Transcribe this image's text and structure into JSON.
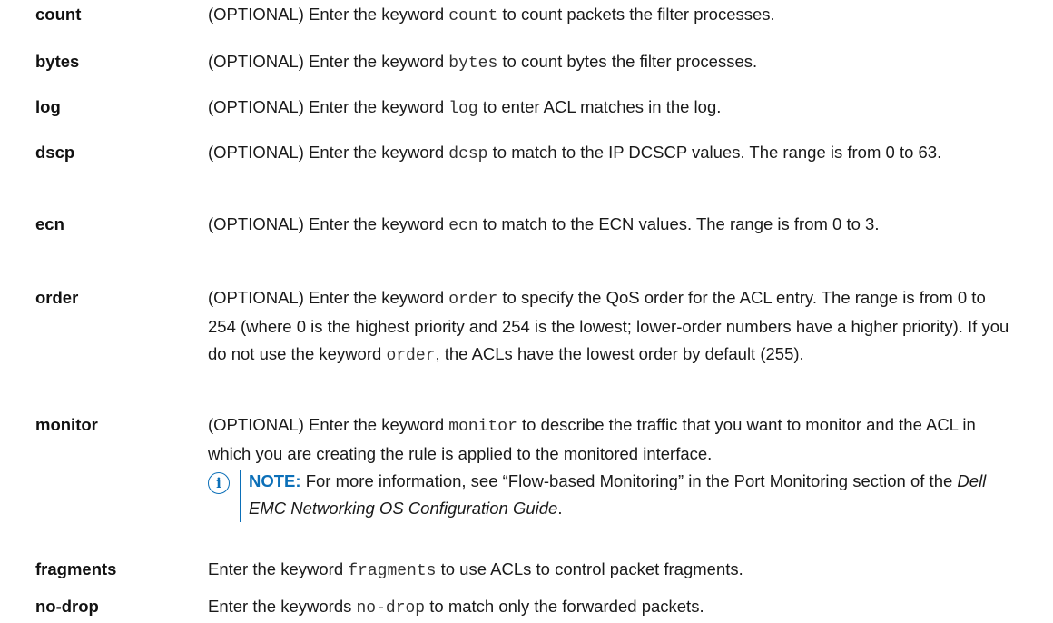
{
  "rows": [
    {
      "term": "count",
      "parts": [
        "(OPTIONAL) Enter the keyword ",
        "count",
        " to count packets the filter processes."
      ]
    },
    {
      "term": "bytes",
      "parts": [
        "(OPTIONAL) Enter the keyword ",
        "bytes",
        " to count bytes the filter processes."
      ]
    },
    {
      "term": "log",
      "parts": [
        "(OPTIONAL) Enter the keyword ",
        "log",
        " to enter ACL matches in the log."
      ]
    },
    {
      "term": "dscp",
      "parts": [
        "(OPTIONAL) Enter the keyword ",
        "dcsp",
        " to match to the IP DCSCP values. The range is from 0 to 63."
      ]
    },
    {
      "term": "ecn",
      "parts": [
        "(OPTIONAL) Enter the keyword ",
        "ecn",
        " to match to the ECN values. The range is from 0 to 3."
      ]
    },
    {
      "term": "order",
      "parts": [
        "(OPTIONAL) Enter the keyword ",
        "order",
        " to specify the QoS order for the ACL entry. The range is from 0 to 254 (where 0 is the highest priority and 254 is the lowest; lower-order numbers have a higher priority). If you do not use the keyword ",
        "order",
        ", the ACLs have the lowest order by default (255)."
      ]
    },
    {
      "term": "monitor",
      "parts": [
        "(OPTIONAL) Enter the keyword ",
        "monitor",
        " to describe the traffic that you want to monitor and the ACL in which you are creating the rule is applied to the monitored interface."
      ]
    },
    {
      "term": "fragments",
      "parts": [
        "Enter the keyword ",
        "fragments",
        " to use ACLs to control packet fragments."
      ]
    },
    {
      "term": "no-drop",
      "parts": [
        "Enter the keywords ",
        "no-drop",
        " to match only the forwarded packets."
      ]
    }
  ],
  "note": {
    "icon": "info-icon",
    "label": "NOTE:",
    "text_before": " For more information, see “Flow-based Monitoring” in the Port Monitoring section of the ",
    "guide": "Dell EMC Networking OS Configuration Guide",
    "text_after": "."
  },
  "colors": {
    "accent": "#0b6fb8",
    "text": "#1a1a1a"
  }
}
